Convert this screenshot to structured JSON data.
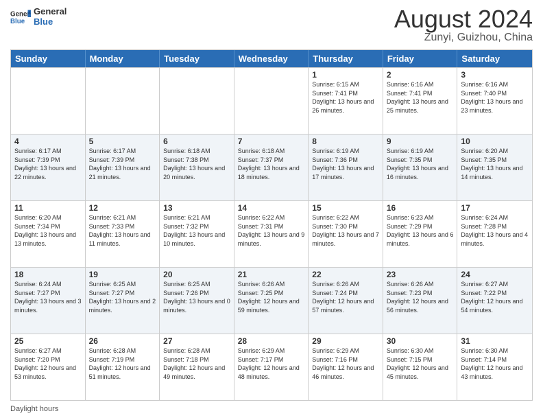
{
  "header": {
    "logo_general": "General",
    "logo_blue": "Blue",
    "main_title": "August 2024",
    "subtitle": "Zunyi, Guizhou, China"
  },
  "days_of_week": [
    "Sunday",
    "Monday",
    "Tuesday",
    "Wednesday",
    "Thursday",
    "Friday",
    "Saturday"
  ],
  "footer_text": "Daylight hours",
  "weeks": [
    [
      {
        "day": "",
        "info": ""
      },
      {
        "day": "",
        "info": ""
      },
      {
        "day": "",
        "info": ""
      },
      {
        "day": "",
        "info": ""
      },
      {
        "day": "1",
        "info": "Sunrise: 6:15 AM\nSunset: 7:41 PM\nDaylight: 13 hours and 26 minutes."
      },
      {
        "day": "2",
        "info": "Sunrise: 6:16 AM\nSunset: 7:41 PM\nDaylight: 13 hours and 25 minutes."
      },
      {
        "day": "3",
        "info": "Sunrise: 6:16 AM\nSunset: 7:40 PM\nDaylight: 13 hours and 23 minutes."
      }
    ],
    [
      {
        "day": "4",
        "info": "Sunrise: 6:17 AM\nSunset: 7:39 PM\nDaylight: 13 hours and 22 minutes."
      },
      {
        "day": "5",
        "info": "Sunrise: 6:17 AM\nSunset: 7:39 PM\nDaylight: 13 hours and 21 minutes."
      },
      {
        "day": "6",
        "info": "Sunrise: 6:18 AM\nSunset: 7:38 PM\nDaylight: 13 hours and 20 minutes."
      },
      {
        "day": "7",
        "info": "Sunrise: 6:18 AM\nSunset: 7:37 PM\nDaylight: 13 hours and 18 minutes."
      },
      {
        "day": "8",
        "info": "Sunrise: 6:19 AM\nSunset: 7:36 PM\nDaylight: 13 hours and 17 minutes."
      },
      {
        "day": "9",
        "info": "Sunrise: 6:19 AM\nSunset: 7:35 PM\nDaylight: 13 hours and 16 minutes."
      },
      {
        "day": "10",
        "info": "Sunrise: 6:20 AM\nSunset: 7:35 PM\nDaylight: 13 hours and 14 minutes."
      }
    ],
    [
      {
        "day": "11",
        "info": "Sunrise: 6:20 AM\nSunset: 7:34 PM\nDaylight: 13 hours and 13 minutes."
      },
      {
        "day": "12",
        "info": "Sunrise: 6:21 AM\nSunset: 7:33 PM\nDaylight: 13 hours and 11 minutes."
      },
      {
        "day": "13",
        "info": "Sunrise: 6:21 AM\nSunset: 7:32 PM\nDaylight: 13 hours and 10 minutes."
      },
      {
        "day": "14",
        "info": "Sunrise: 6:22 AM\nSunset: 7:31 PM\nDaylight: 13 hours and 9 minutes."
      },
      {
        "day": "15",
        "info": "Sunrise: 6:22 AM\nSunset: 7:30 PM\nDaylight: 13 hours and 7 minutes."
      },
      {
        "day": "16",
        "info": "Sunrise: 6:23 AM\nSunset: 7:29 PM\nDaylight: 13 hours and 6 minutes."
      },
      {
        "day": "17",
        "info": "Sunrise: 6:24 AM\nSunset: 7:28 PM\nDaylight: 13 hours and 4 minutes."
      }
    ],
    [
      {
        "day": "18",
        "info": "Sunrise: 6:24 AM\nSunset: 7:27 PM\nDaylight: 13 hours and 3 minutes."
      },
      {
        "day": "19",
        "info": "Sunrise: 6:25 AM\nSunset: 7:27 PM\nDaylight: 13 hours and 2 minutes."
      },
      {
        "day": "20",
        "info": "Sunrise: 6:25 AM\nSunset: 7:26 PM\nDaylight: 13 hours and 0 minutes."
      },
      {
        "day": "21",
        "info": "Sunrise: 6:26 AM\nSunset: 7:25 PM\nDaylight: 12 hours and 59 minutes."
      },
      {
        "day": "22",
        "info": "Sunrise: 6:26 AM\nSunset: 7:24 PM\nDaylight: 12 hours and 57 minutes."
      },
      {
        "day": "23",
        "info": "Sunrise: 6:26 AM\nSunset: 7:23 PM\nDaylight: 12 hours and 56 minutes."
      },
      {
        "day": "24",
        "info": "Sunrise: 6:27 AM\nSunset: 7:22 PM\nDaylight: 12 hours and 54 minutes."
      }
    ],
    [
      {
        "day": "25",
        "info": "Sunrise: 6:27 AM\nSunset: 7:20 PM\nDaylight: 12 hours and 53 minutes."
      },
      {
        "day": "26",
        "info": "Sunrise: 6:28 AM\nSunset: 7:19 PM\nDaylight: 12 hours and 51 minutes."
      },
      {
        "day": "27",
        "info": "Sunrise: 6:28 AM\nSunset: 7:18 PM\nDaylight: 12 hours and 49 minutes."
      },
      {
        "day": "28",
        "info": "Sunrise: 6:29 AM\nSunset: 7:17 PM\nDaylight: 12 hours and 48 minutes."
      },
      {
        "day": "29",
        "info": "Sunrise: 6:29 AM\nSunset: 7:16 PM\nDaylight: 12 hours and 46 minutes."
      },
      {
        "day": "30",
        "info": "Sunrise: 6:30 AM\nSunset: 7:15 PM\nDaylight: 12 hours and 45 minutes."
      },
      {
        "day": "31",
        "info": "Sunrise: 6:30 AM\nSunset: 7:14 PM\nDaylight: 12 hours and 43 minutes."
      }
    ]
  ]
}
